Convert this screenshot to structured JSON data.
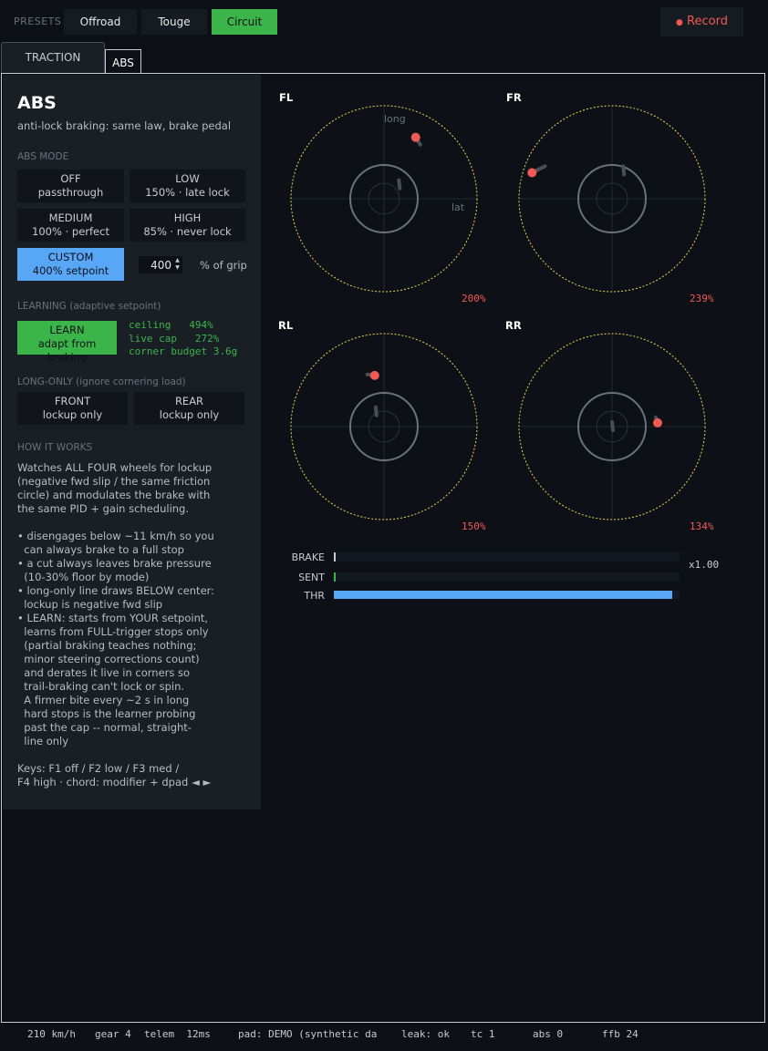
{
  "presets": {
    "label": "PRESETS",
    "items": [
      "Offroad",
      "Touge",
      "Circuit"
    ],
    "active": "Circuit"
  },
  "record_label": "Record",
  "record_dot": "●",
  "tabs": [
    "TRACTION",
    "ABS"
  ],
  "abs": {
    "title": "ABS",
    "subtitle": "anti-lock braking: same law, brake pedal",
    "mode_label": "ABS MODE",
    "modes": [
      {
        "name": "OFF",
        "desc": "passthrough"
      },
      {
        "name": "LOW",
        "desc": "150% · late lock"
      },
      {
        "name": "MEDIUM",
        "desc": "100% · perfect"
      },
      {
        "name": "HIGH",
        "desc": "85% · never lock"
      },
      {
        "name": "CUSTOM",
        "desc": "400% setpoint"
      }
    ],
    "active_mode": "CUSTOM",
    "custom_value": "400",
    "custom_unit": "% of grip",
    "learning_label": "LEARNING  (adaptive setpoint)",
    "learn_button": {
      "name": "LEARN",
      "desc": "adapt from braking"
    },
    "learn_stats": "ceiling   494%\nlive cap   272%\ncorner budget 3.6g",
    "long_only_label": "LONG-ONLY  (ignore cornering load)",
    "long_only_buttons": [
      {
        "name": "FRONT",
        "desc": "lockup only"
      },
      {
        "name": "REAR",
        "desc": "lockup only"
      }
    ],
    "how_label": "HOW IT WORKS",
    "how_text": "Watches ALL FOUR wheels for lockup\n(negative fwd slip / the same friction\ncircle) and modulates the brake with\nthe same PID + gain scheduling.\n\n• disengages below ~11 km/h so you\n  can always brake to a full stop\n• a cut always leaves brake pressure\n  (10-30% floor by mode)\n• long-only line draws BELOW center:\n  lockup is negative fwd slip\n• LEARN: starts from YOUR setpoint,\n  learns from FULL-trigger stops only\n  (partial braking teaches nothing;\n  minor steering corrections count)\n  and derates it live in corners so\n  trail-braking can't lock or spin.\n  A firmer bite every ~2 s in long\n  hard stops is the learner probing\n  past the cap -- normal, straight-\n  line only\n\nKeys: F1 off / F2 low / F3 med /\nF4 high · chord: modifier + dpad ◄ ►"
  },
  "wheels": [
    {
      "id": "FL",
      "pct": "200%",
      "dot_x": 0.34,
      "dot_y": 0.66,
      "tail_x": 0.39,
      "tail_y": 0.58,
      "inner_x": 0.16,
      "inner_y": 0.15
    },
    {
      "id": "FR",
      "pct": "239%",
      "dot_x": -0.86,
      "dot_y": 0.28,
      "tail_x": -0.72,
      "tail_y": 0.35,
      "inner_x": 0.12,
      "inner_y": 0.3
    },
    {
      "id": "RL",
      "pct": "150%",
      "dot_x": -0.1,
      "dot_y": 0.55,
      "tail_x": -0.18,
      "tail_y": 0.56,
      "inner_x": -0.09,
      "inner_y": 0.16
    },
    {
      "id": "RR",
      "pct": "134%",
      "dot_x": 0.49,
      "dot_y": 0.04,
      "tail_x": 0.47,
      "tail_y": 0.1,
      "inner_x": 0.0,
      "inner_y": 0.0
    }
  ],
  "axis_labels": {
    "long": "long",
    "lat": "lat"
  },
  "colors": {
    "accent_green": "#3bb54a",
    "accent_blue": "#58a6f6",
    "alert_red": "#f05a55",
    "limit_yellow": "#e8d84a"
  },
  "bars": [
    {
      "label": "BRAKE",
      "value": 0.0,
      "color": "#c8ccd2"
    },
    {
      "label": "SENT",
      "value": 0.0,
      "color": "#3bb54a"
    },
    {
      "label": "THR",
      "value": 0.98,
      "color": "#58a6f6"
    }
  ],
  "multiplier": "x1.00",
  "status": {
    "speed": "210 km/h",
    "gear": "gear 4",
    "telem": "telem  12ms",
    "pad": "pad: DEMO (synthetic da",
    "leak": "leak: ok",
    "tc": "tc 1",
    "abs": "abs 0",
    "ffb": "ffb 24"
  }
}
